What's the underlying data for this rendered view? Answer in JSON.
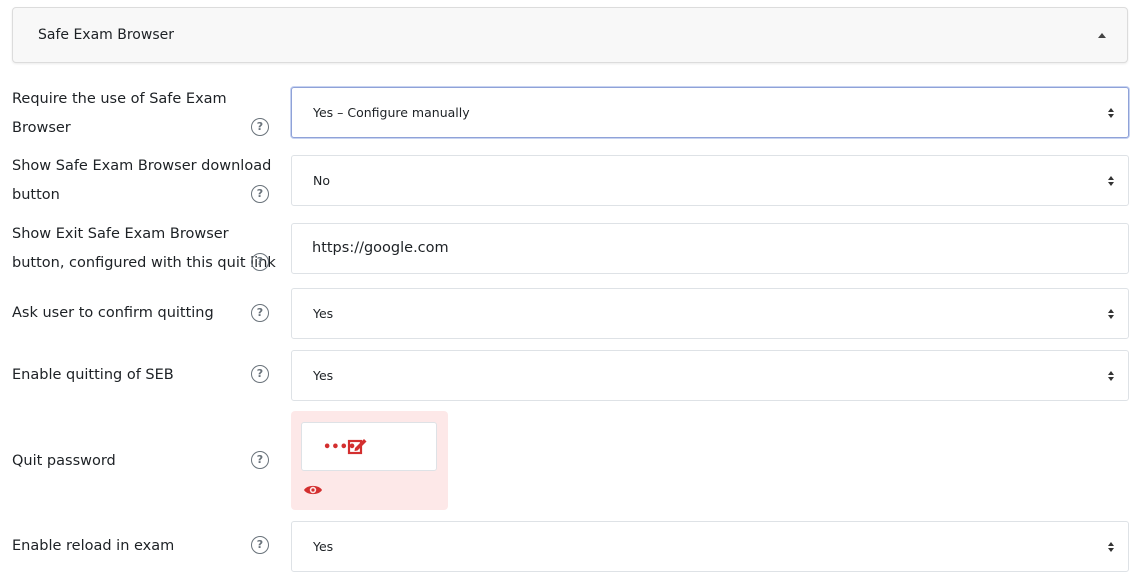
{
  "section": {
    "title": "Safe Exam Browser",
    "collapse_icon": "caret-up-icon"
  },
  "fields": {
    "require_seb": {
      "label": "Require the use of Safe Exam Browser",
      "value": "Yes – Configure manually"
    },
    "show_download": {
      "label": "Show Safe Exam Browser download button",
      "value": "No"
    },
    "show_exit": {
      "label": "Show Exit Safe Exam Browser button, configured with this quit link",
      "value": "https://google.com"
    },
    "confirm_quit": {
      "label": "Ask user to confirm quitting",
      "value": "Yes"
    },
    "enable_quit": {
      "label": "Enable quitting of SEB",
      "value": "Yes"
    },
    "quit_password": {
      "label": "Quit password",
      "masked_value": "••••",
      "edit_icon": "edit-icon",
      "reveal_icon": "eye-icon"
    },
    "enable_reload": {
      "label": "Enable reload in exam",
      "value": "Yes"
    }
  },
  "help_icon_glyph": "?",
  "colors": {
    "accent_error": "#d32f2f",
    "error_bg": "#fde8e8",
    "focus_border": "#8fa2d8"
  }
}
